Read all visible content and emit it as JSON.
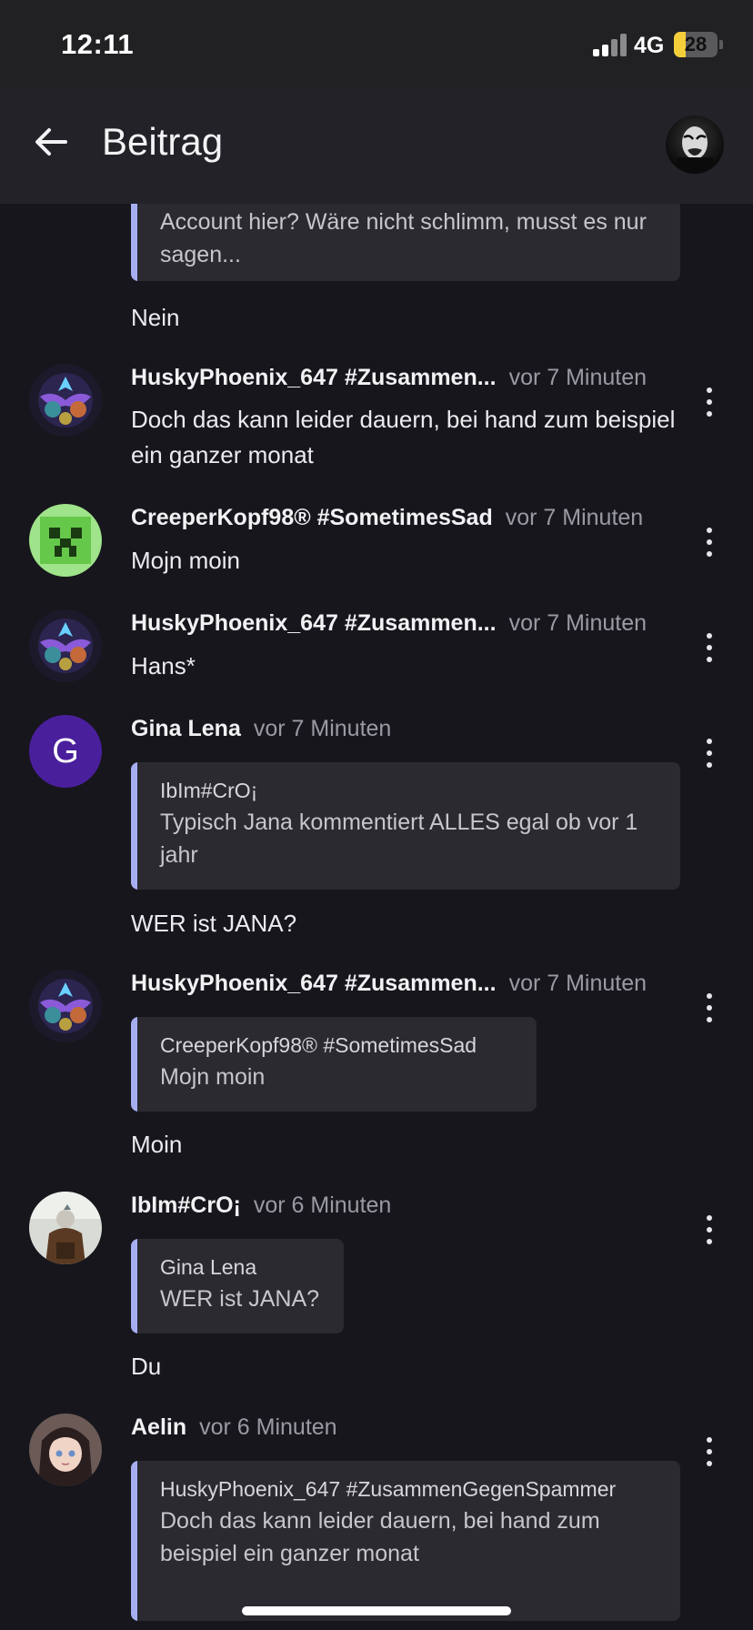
{
  "status_bar": {
    "time": "12:11",
    "network": "4G",
    "battery": "28",
    "battery_level": 0.28
  },
  "header": {
    "title": "Beitrag",
    "back_icon": "arrow-left-icon",
    "avatar": "profile-avatar"
  },
  "feed": {
    "partial_comment": {
      "quote_text": "Account hier? Wäre nicht schlimm, musst es nur sagen...",
      "text": "Nein"
    },
    "comments": [
      {
        "author": "HuskyPhoenix_647 #Zusammen...",
        "time": "vor 7 Minuten",
        "text": "Doch das kann leider dauern, bei hand zum beispiel ein ganzer monat"
      },
      {
        "author": "CreeperKopf98® #SometimesSad",
        "time": "vor 7 Minuten",
        "text": "Mojn moin"
      },
      {
        "author": "HuskyPhoenix_647 #Zusammen...",
        "time": "vor 7 Minuten",
        "text": "Hans*"
      },
      {
        "author": "Gina Lena",
        "avatar_letter": "G",
        "time": "vor 7 Minuten",
        "quote_author": "IbIm#CrO¡",
        "quote_text": "Typisch Jana kommentiert ALLES egal ob vor 1 jahr",
        "text": "WER ist JANA?"
      },
      {
        "author": "HuskyPhoenix_647 #Zusammen...",
        "time": "vor 7 Minuten",
        "quote_author": "CreeperKopf98® #SometimesSad",
        "quote_text": "Mojn moin",
        "text": "Moin"
      },
      {
        "author": "IbIm#CrO¡",
        "time": "vor 6 Minuten",
        "quote_author": "Gina Lena",
        "quote_text": "WER ist JANA?",
        "text": "Du"
      },
      {
        "author": "Aelin",
        "time": "vor 6 Minuten",
        "quote_author": "HuskyPhoenix_647 #ZusammenGegenSpammer",
        "quote_text": "Doch das kann leider dauern, bei hand zum beispiel ein ganzer monat"
      }
    ]
  },
  "colors": {
    "background": "#16161c",
    "header": "#222228",
    "quote_background": "#2a2a30",
    "quote_accent": "#a6aef0",
    "avatar_letter_bg": "#4a1f9c",
    "muted_text": "#9a9aa2"
  }
}
